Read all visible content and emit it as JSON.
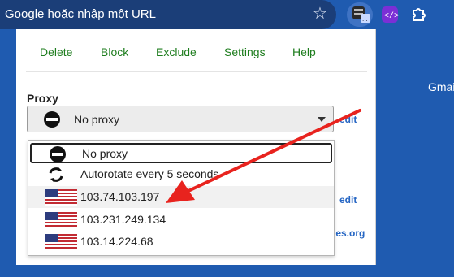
{
  "browser": {
    "omnibox_placeholder": "Google hoặc nhập một URL",
    "page_text_gmail": "Gmail"
  },
  "menu": {
    "items": [
      "Delete",
      "Block",
      "Exclude",
      "Settings",
      "Help"
    ]
  },
  "proxy": {
    "label": "Proxy",
    "selected_value": "No proxy",
    "edit_label": "edit",
    "edit_label_2": "edit",
    "side_text": "ties.org"
  },
  "dropdown": {
    "options": [
      {
        "label": "No proxy",
        "icon": "no-entry-icon"
      },
      {
        "label": "Autorotate every 5 seconds",
        "icon": "refresh-icon"
      },
      {
        "label": "103.74.103.197",
        "icon": "us-flag-icon"
      },
      {
        "label": "103.231.249.134",
        "icon": "us-flag-icon"
      },
      {
        "label": "103.14.224.68",
        "icon": "us-flag-icon"
      }
    ]
  },
  "colors": {
    "menu_link": "#1e7d1e",
    "edit_link": "#2767c4",
    "browser_bg": "#1f5bb0",
    "annotation_arrow": "#e8231e"
  }
}
